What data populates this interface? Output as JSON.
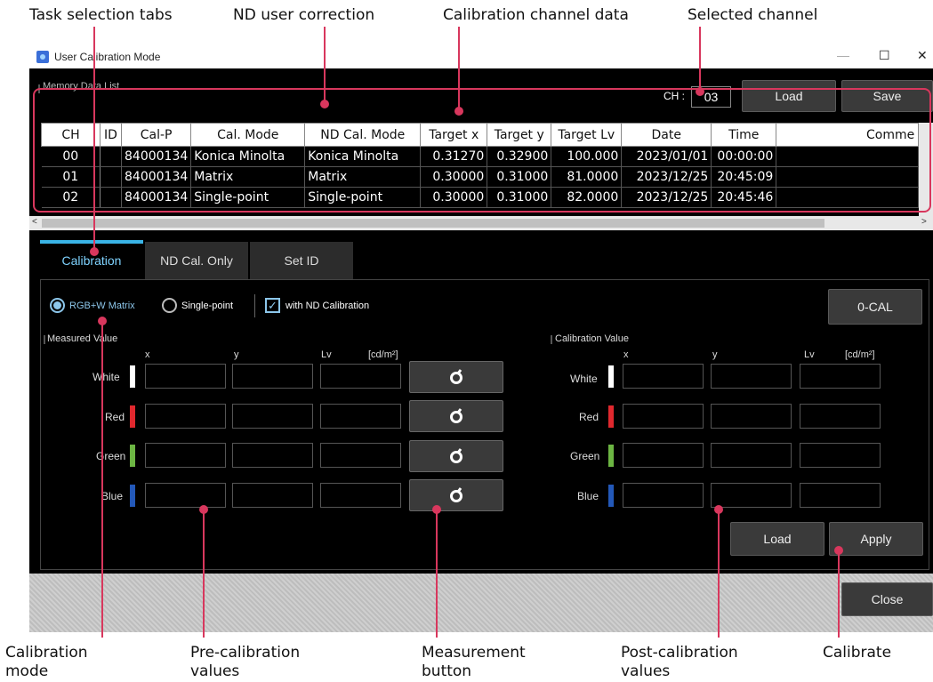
{
  "callouts": {
    "task_tabs": "Task selection tabs",
    "nd_correction": "ND user correction",
    "cal_channel_data": "Calibration channel data",
    "selected_channel": "Selected channel",
    "calibration_mode": "Calibration mode",
    "pre_cal": "Pre-calibration values",
    "measurement_button": "Measurement button",
    "post_cal": "Post-calibration values",
    "calibrate": "Calibrate"
  },
  "window": {
    "title": "User Calibration Mode",
    "minimize": "—",
    "maximize": "☐",
    "close": "✕"
  },
  "memory": {
    "group_label": "Memory Data List",
    "ch_label": "CH :",
    "ch_value": "03",
    "load": "Load",
    "save": "Save"
  },
  "table": {
    "headers": [
      "CH",
      "ID",
      "Cal-P",
      "Cal. Mode",
      "ND Cal. Mode",
      "Target x",
      "Target y",
      "Target Lv",
      "Date",
      "Time",
      "Comme"
    ],
    "rows": [
      {
        "ch": "00",
        "id": "",
        "calp": "84000134",
        "mode": "Konica Minolta",
        "nd": "Konica Minolta",
        "tx": "0.31270",
        "ty": "0.32900",
        "tlv": "100.000",
        "date": "2023/01/01",
        "time": "00:00:00",
        "comment": ""
      },
      {
        "ch": "01",
        "id": "",
        "calp": "84000134",
        "mode": "Matrix",
        "nd": "Matrix",
        "tx": "0.30000",
        "ty": "0.31000",
        "tlv": "81.0000",
        "date": "2023/12/25",
        "time": "20:45:09",
        "comment": ""
      },
      {
        "ch": "02",
        "id": "",
        "calp": "84000134",
        "mode": "Single-point",
        "nd": "Single-point",
        "tx": "0.30000",
        "ty": "0.31000",
        "tlv": "82.0000",
        "date": "2023/12/25",
        "time": "20:45:46",
        "comment": ""
      }
    ]
  },
  "tabs": [
    "Calibration",
    "ND Cal. Only",
    "Set ID"
  ],
  "modes": {
    "rgbw": "RGB+W Matrix",
    "single": "Single-point",
    "with_nd": "with ND Calibration",
    "zero_cal": "0-CAL"
  },
  "measured": {
    "group_label": "Measured Value",
    "col_x": "x",
    "col_y": "y",
    "col_lv": "Lv",
    "unit": "[cd/m²]"
  },
  "calib": {
    "group_label": "Calibration Value",
    "col_x": "x",
    "col_y": "y",
    "col_lv": "Lv",
    "unit": "[cd/m²]"
  },
  "colors": {
    "white": {
      "label": "White",
      "swatch": "#ffffff"
    },
    "red": {
      "label": "Red",
      "swatch": "#e0282e"
    },
    "green": {
      "label": "Green",
      "swatch": "#6cb543"
    },
    "blue": {
      "label": "Blue",
      "swatch": "#2358b8"
    }
  },
  "bottom": {
    "load": "Load",
    "apply": "Apply",
    "close": "Close"
  },
  "accent": "#3ab4e6",
  "callout_color": "#d8375d"
}
